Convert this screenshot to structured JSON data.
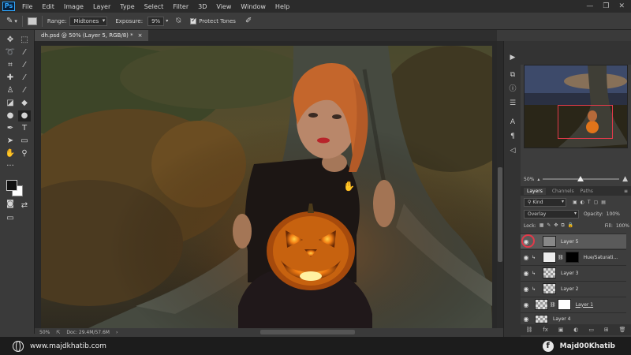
{
  "app": {
    "logo": "Ps"
  },
  "menu": [
    "File",
    "Edit",
    "Image",
    "Layer",
    "Type",
    "Select",
    "Filter",
    "3D",
    "View",
    "Window",
    "Help"
  ],
  "window_controls": [
    "—",
    "❐",
    "✕"
  ],
  "options": {
    "range_label": "Range:",
    "range_value": "Midtones",
    "exposure_label": "Exposure:",
    "exposure_value": "9%",
    "protect_tones_label": "Protect Tones"
  },
  "document": {
    "tab_title": "dh.psd @ 50% (Layer 5, RGB/8) *",
    "close": "×"
  },
  "status": {
    "zoom": "50%",
    "doc_size": "Doc: 29.4M/57.6M"
  },
  "navigator": {
    "zoom": "50%"
  },
  "layers_panel": {
    "tabs": [
      "Layers",
      "Channels",
      "Paths"
    ],
    "kind_label": "Kind",
    "blend_mode": "Overlay",
    "opacity_label": "Opacity:",
    "opacity_value": "100%",
    "lock_label": "Lock:",
    "fill_label": "Fill:",
    "fill_value": "100%",
    "layers": [
      {
        "name": "Layer 5"
      },
      {
        "name": "Hue/Saturati..."
      },
      {
        "name": "Layer 3"
      },
      {
        "name": "Layer 2"
      },
      {
        "name": "Layer 1"
      },
      {
        "name": "Layer 4"
      }
    ],
    "footer_icons": [
      "fx",
      "◐",
      "▣",
      "▭",
      "⊞",
      "🗑"
    ]
  },
  "banner": {
    "website": "www.majdkhatib.com",
    "fb_icon": "f",
    "handle": "Majd00Khatib"
  },
  "colors": {
    "accent_red": "#e23a4a",
    "ps_blue": "#31a8ff"
  }
}
